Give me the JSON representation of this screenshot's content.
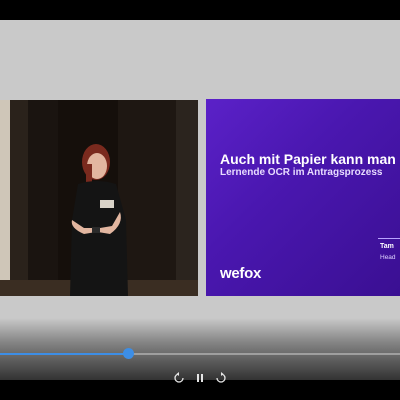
{
  "slide": {
    "title": "Auch mit Papier kann man",
    "subtitle": "Lernende OCR im Antragsprozess",
    "presenter_name": "Tam",
    "presenter_role": "Head",
    "logo": "wefox",
    "background_color": "#4a17b0"
  },
  "player": {
    "progress_fraction": 0.32,
    "accent_color": "#3d8ee6",
    "controls": [
      {
        "icon": "rewind-icon"
      },
      {
        "icon": "pause-icon"
      },
      {
        "icon": "forward-icon"
      }
    ]
  }
}
